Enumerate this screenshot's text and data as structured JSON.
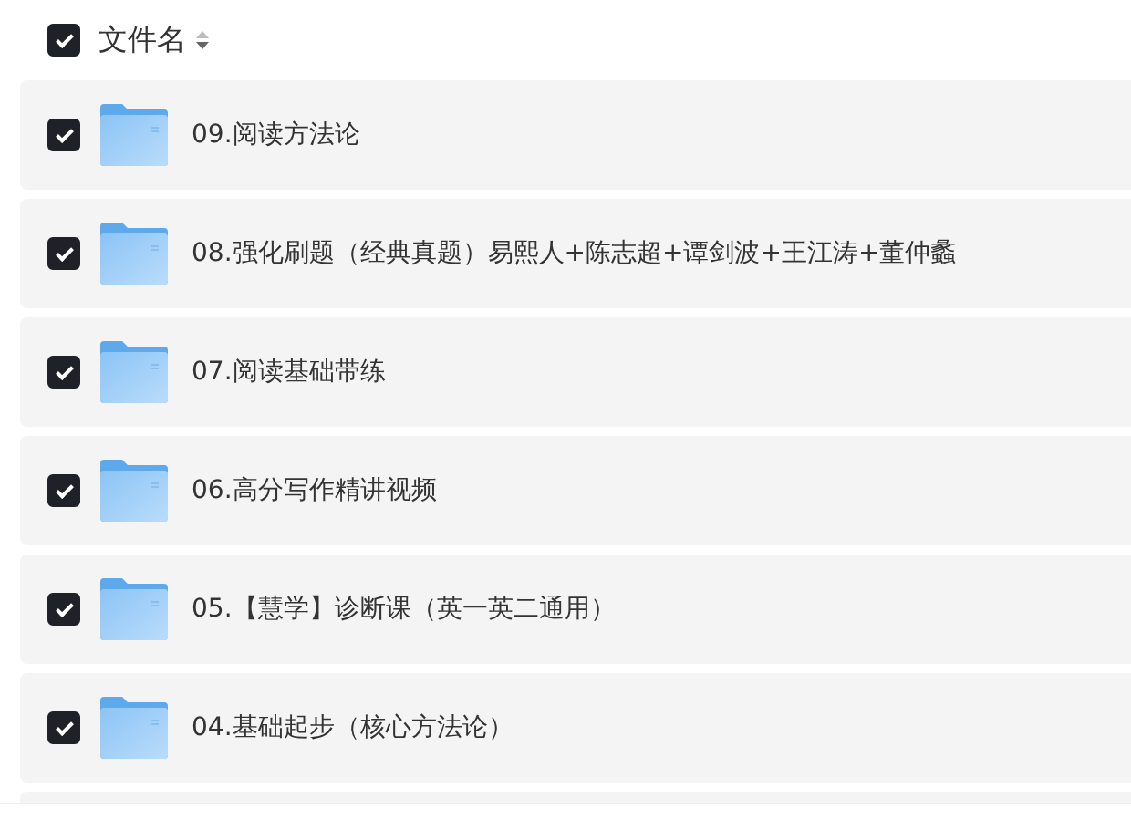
{
  "header": {
    "checked": true,
    "label": "文件名"
  },
  "files": [
    {
      "name": "09.阅读方法论",
      "checked": true
    },
    {
      "name": "08.强化刷题（经典真题）易熙人+陈志超+谭剑波+王江涛+董仲蠡",
      "checked": true
    },
    {
      "name": "07.阅读基础带练",
      "checked": true
    },
    {
      "name": "06.高分写作精讲视频",
      "checked": true
    },
    {
      "name": "05.【慧学】诊断课（英一英二通用）",
      "checked": true
    },
    {
      "name": "04.基础起步（核心方法论）",
      "checked": true
    }
  ]
}
